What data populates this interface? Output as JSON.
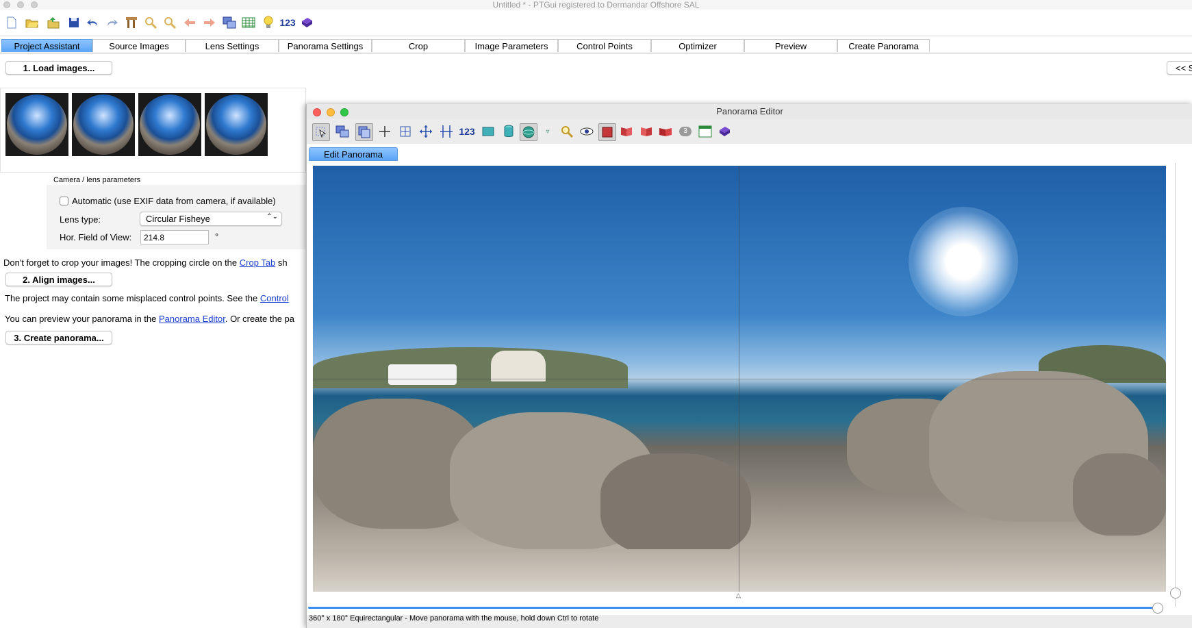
{
  "window": {
    "title": "Untitled * - PTGui registered to Dermandar Offshore SAL"
  },
  "toolbar": {
    "icons": [
      "new-file-icon",
      "open-folder-icon",
      "open-recent-icon",
      "save-icon",
      "undo-icon",
      "redo-icon",
      "tools-icon",
      "zoom-in-icon",
      "zoom-out-icon",
      "back-arrow-icon",
      "forward-arrow-icon",
      "panorama-editor-icon",
      "table-icon",
      "lightbulb-icon"
    ],
    "numeric_label": "123"
  },
  "tabs": [
    "Project Assistant",
    "Source Images",
    "Lens Settings",
    "Panorama Settings",
    "Crop",
    "Image Parameters",
    "Control Points",
    "Optimizer",
    "Preview",
    "Create Panorama"
  ],
  "active_tab": "Project Assistant",
  "collapse_label": "<< S",
  "assistant": {
    "load_button": "1. Load images...",
    "camera_section_label": "Camera / lens parameters",
    "auto_checkbox_label": "Automatic (use EXIF data from camera, if available)",
    "lens_type_label": "Lens type:",
    "lens_type_value": "Circular Fisheye",
    "hfov_label": "Hor. Field of View:",
    "hfov_value": "214.8",
    "hfov_unit": "°",
    "crop_note_prefix": "Don't forget to crop your images! The cropping circle on the ",
    "crop_note_link": "Crop Tab",
    "crop_note_suffix": " sh",
    "align_button": "2. Align images...",
    "cp_note_prefix": "The project may contain some misplaced control points. See the ",
    "cp_note_link": "Control",
    "preview_note_prefix": "You can preview your panorama in the ",
    "preview_note_link": "Panorama Editor",
    "preview_note_suffix": ". Or create the pa",
    "create_button": "3. Create panorama..."
  },
  "panorama_editor": {
    "title": "Panorama Editor",
    "toolbar_numeric_label": "123",
    "badge_number": "3",
    "tab_label": "Edit Panorama",
    "status": "360° x 180° Equirectangular - Move panorama with the mouse, hold down Ctrl to rotate"
  }
}
